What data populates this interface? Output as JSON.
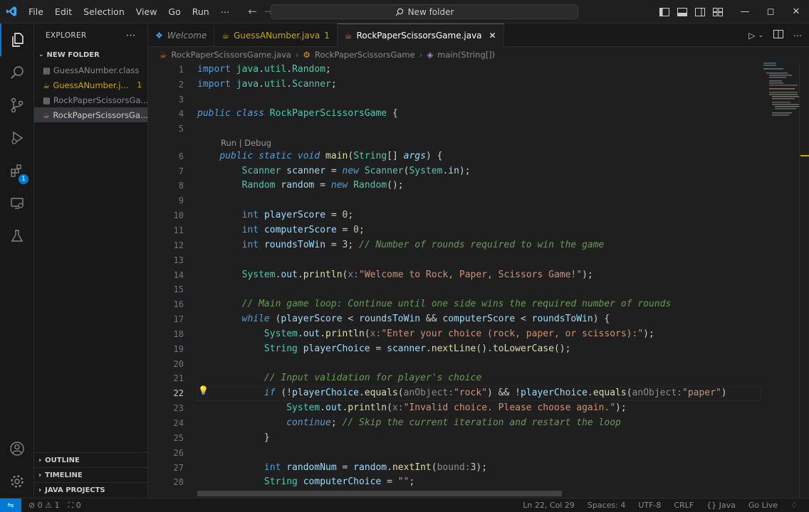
{
  "titlebar": {
    "menu": [
      "File",
      "Edit",
      "Selection",
      "View",
      "Go",
      "Run",
      "⋯"
    ],
    "search": "New folder"
  },
  "sidebar": {
    "title": "EXPLORER",
    "folder": "NEW FOLDER",
    "files": [
      {
        "name": "GuessANumber.class",
        "state": "dim",
        "count": ""
      },
      {
        "name": "GuessANumber.j...",
        "state": "err",
        "count": "1"
      },
      {
        "name": "RockPaperScissorsGa...",
        "state": "dim",
        "count": ""
      },
      {
        "name": "RockPaperScissorsGa...",
        "state": "selected",
        "count": ""
      }
    ],
    "sections": [
      "OUTLINE",
      "TIMELINE",
      "JAVA PROJECTS"
    ]
  },
  "activity": {
    "extensions_badge": "1"
  },
  "tabs": [
    {
      "label": "Welcome",
      "kind": "welcome"
    },
    {
      "label": "GuessANumber.java",
      "kind": "err",
      "count": "1"
    },
    {
      "label": "RockPaperScissorsGame.java",
      "kind": "active"
    }
  ],
  "breadcrumb": [
    "RockPaperScissorsGame.java",
    "RockPaperScissorsGame",
    "main(String[])"
  ],
  "editor": {
    "codelens": "Run | Debug",
    "active_line": "22"
  },
  "statusbar": {
    "left": [
      "⊘ 0 ⚠ 1",
      "⛶ 0"
    ],
    "right": [
      "Ln 22, Col 29",
      "Spaces: 4",
      "UTF-8",
      "CRLF",
      "{} Java",
      "Go Live"
    ]
  },
  "colors": {
    "accent": "#0078d4",
    "warning": "#cca700",
    "editor_bg": "#1f1f1f"
  }
}
